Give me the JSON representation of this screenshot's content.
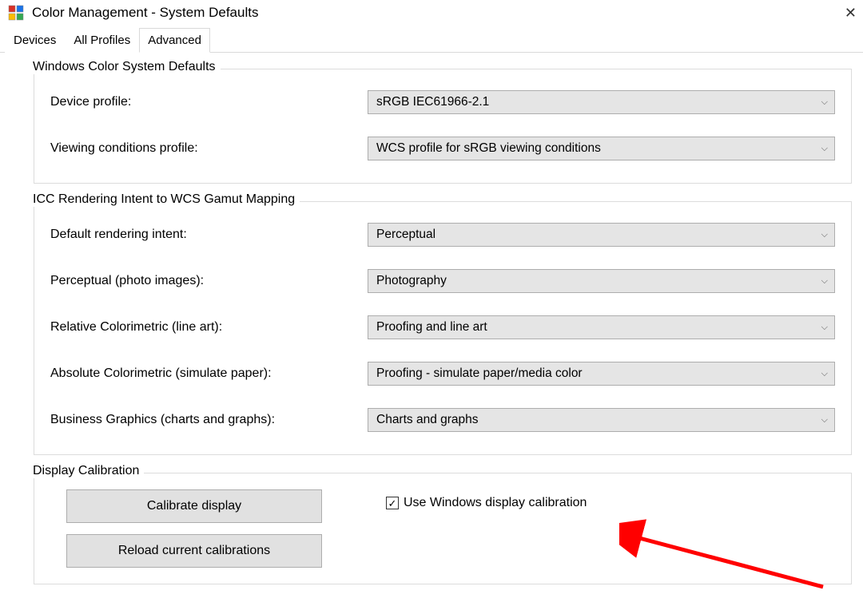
{
  "window": {
    "title": "Color Management - System Defaults"
  },
  "tabs": {
    "devices": "Devices",
    "allProfiles": "All Profiles",
    "advanced": "Advanced"
  },
  "group1": {
    "legend": "Windows Color System Defaults",
    "deviceProfileLabel": "Device profile:",
    "deviceProfileValue": "sRGB IEC61966-2.1",
    "viewingLabel": "Viewing conditions profile:",
    "viewingValue": "WCS profile for sRGB viewing conditions"
  },
  "group2": {
    "legend": "ICC Rendering Intent to WCS Gamut Mapping",
    "defaultIntentLabel": "Default rendering intent:",
    "defaultIntentValue": "Perceptual",
    "perceptualLabel": "Perceptual (photo images):",
    "perceptualValue": "Photography",
    "relativeLabel": "Relative Colorimetric (line art):",
    "relativeValue": "Proofing and line art",
    "absoluteLabel": "Absolute Colorimetric (simulate paper):",
    "absoluteValue": "Proofing - simulate paper/media color",
    "businessLabel": "Business Graphics (charts and graphs):",
    "businessValue": "Charts and graphs"
  },
  "group3": {
    "legend": "Display Calibration",
    "calibrateBtn": "Calibrate display",
    "reloadBtn": "Reload current calibrations",
    "checkboxLabel": "Use Windows display calibration"
  }
}
